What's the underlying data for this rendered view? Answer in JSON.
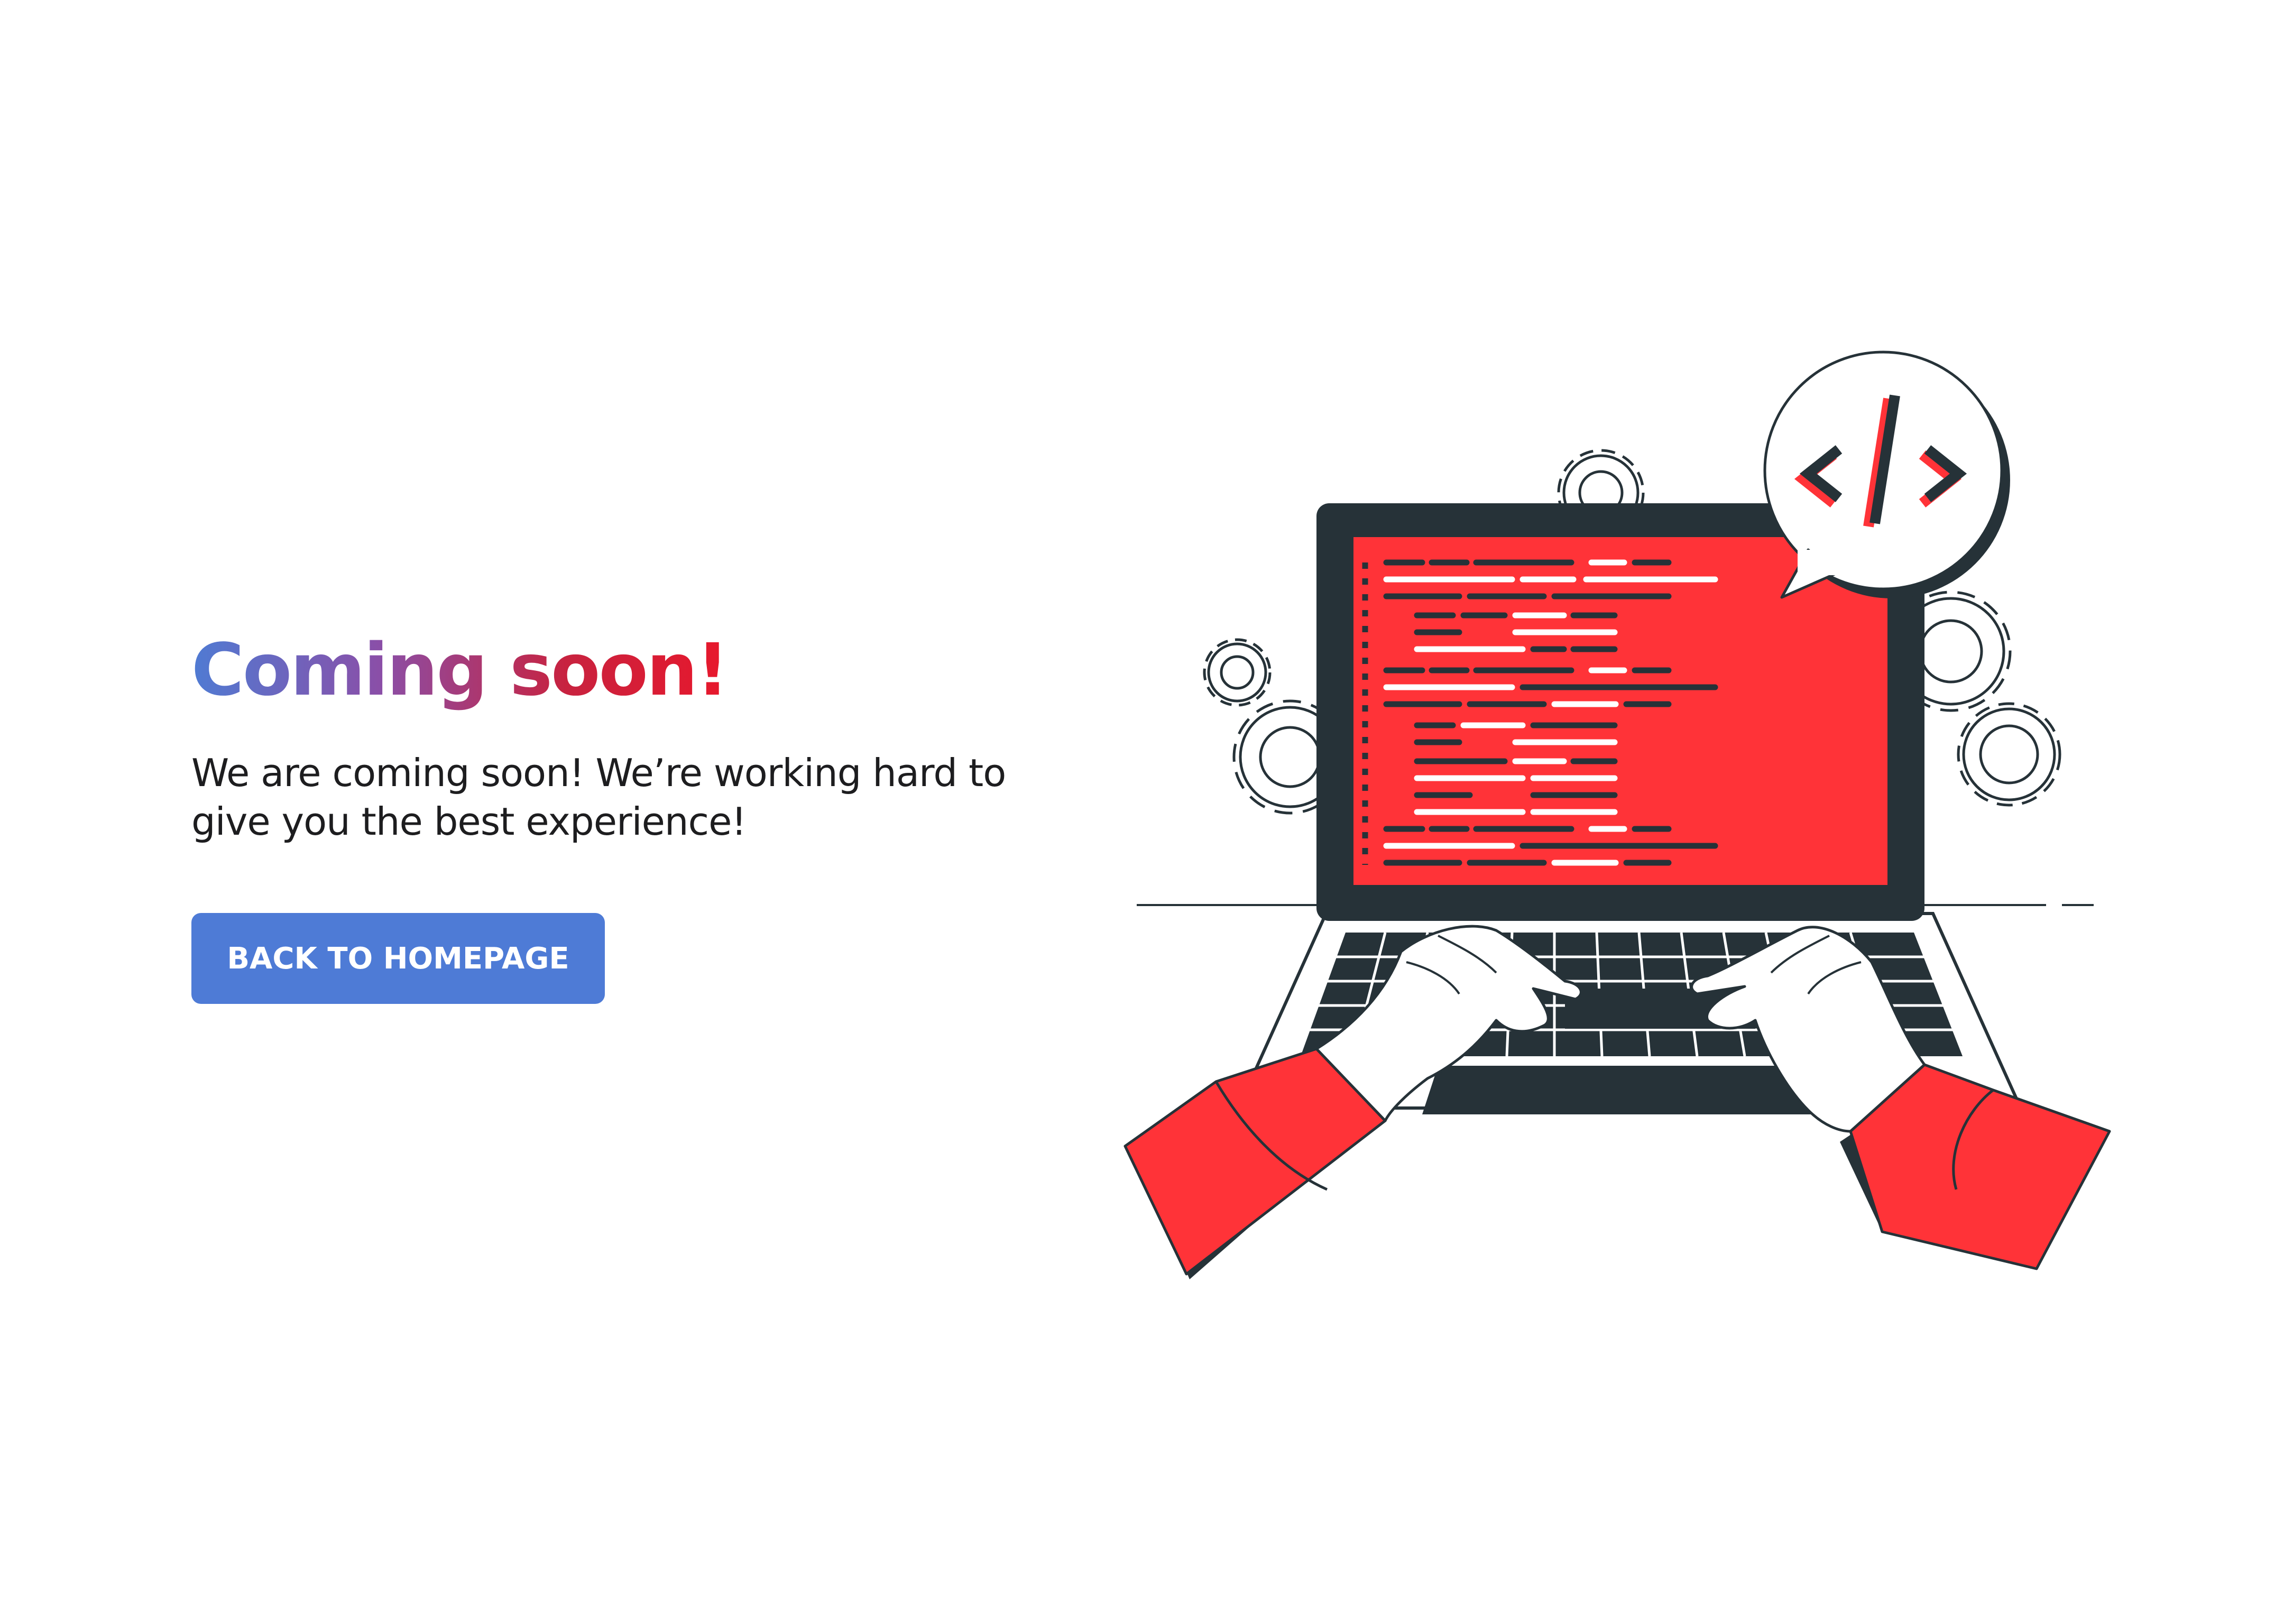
{
  "hero": {
    "title": "Coming soon!",
    "description": "We are coming soon! We’re working hard to give you the best experience!",
    "cta_label": "BACK TO HOMEPAGE"
  },
  "illustration": {
    "code_bubble_glyph": "</>",
    "icon_names": [
      "laptop-icon",
      "code-bubble-icon",
      "gear-icon",
      "hands-typing-icon"
    ]
  },
  "colors": {
    "accent_blue": "#4e7bd6",
    "accent_red": "#ff3338",
    "title_gradient_start": "#4f7bd3",
    "title_gradient_end": "#e8182c",
    "dark": "#263238"
  }
}
